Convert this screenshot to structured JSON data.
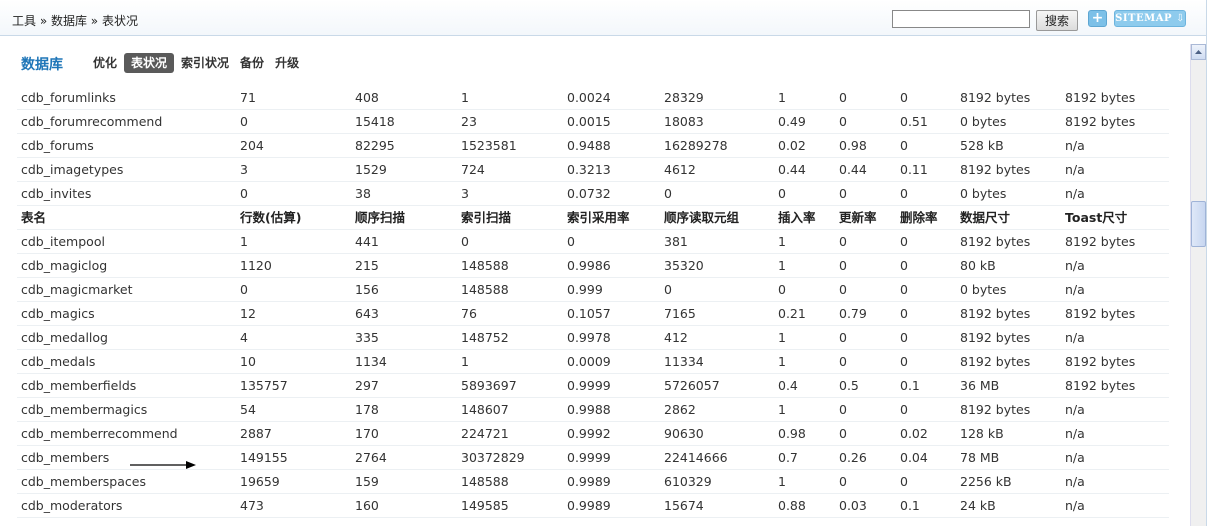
{
  "breadcrumb": "工具 » 数据库 » 表状况",
  "search": {
    "button_label": "搜索",
    "value": ""
  },
  "header_buttons": {
    "plus_label": "+",
    "sitemap_label": "SITEMAP ⇩"
  },
  "page": {
    "title": "数据库",
    "tabs": [
      {
        "label": "优化",
        "active": false
      },
      {
        "label": "表状况",
        "active": true
      },
      {
        "label": "索引状况",
        "active": false
      },
      {
        "label": "备份",
        "active": false
      },
      {
        "label": "升级",
        "active": false
      }
    ]
  },
  "table": {
    "rows_before_header": [
      [
        "cdb_forumlinks",
        "71",
        "408",
        "1",
        "0.0024",
        "28329",
        "1",
        "0",
        "0",
        "8192 bytes",
        "8192 bytes"
      ],
      [
        "cdb_forumrecommend",
        "0",
        "15418",
        "23",
        "0.0015",
        "18083",
        "0.49",
        "0",
        "0.51",
        "0 bytes",
        "8192 bytes"
      ],
      [
        "cdb_forums",
        "204",
        "82295",
        "1523581",
        "0.9488",
        "16289278",
        "0.02",
        "0.98",
        "0",
        "528 kB",
        "n/a"
      ],
      [
        "cdb_imagetypes",
        "3",
        "1529",
        "724",
        "0.3213",
        "4612",
        "0.44",
        "0.44",
        "0.11",
        "8192 bytes",
        "n/a"
      ],
      [
        "cdb_invites",
        "0",
        "38",
        "3",
        "0.0732",
        "0",
        "0",
        "0",
        "0",
        "0 bytes",
        "n/a"
      ]
    ],
    "columns": [
      "表名",
      "行数(估算)",
      "顺序扫描",
      "索引扫描",
      "索引采用率",
      "顺序读取元组",
      "插入率",
      "更新率",
      "删除率",
      "数据尺寸",
      "Toast尺寸"
    ],
    "rows_after_header": [
      [
        "cdb_itempool",
        "1",
        "441",
        "0",
        "0",
        "381",
        "1",
        "0",
        "0",
        "8192 bytes",
        "8192 bytes"
      ],
      [
        "cdb_magiclog",
        "1120",
        "215",
        "148588",
        "0.9986",
        "35320",
        "1",
        "0",
        "0",
        "80 kB",
        "n/a"
      ],
      [
        "cdb_magicmarket",
        "0",
        "156",
        "148588",
        "0.999",
        "0",
        "0",
        "0",
        "0",
        "0 bytes",
        "n/a"
      ],
      [
        "cdb_magics",
        "12",
        "643",
        "76",
        "0.1057",
        "7165",
        "0.21",
        "0.79",
        "0",
        "8192 bytes",
        "8192 bytes"
      ],
      [
        "cdb_medallog",
        "4",
        "335",
        "148752",
        "0.9978",
        "412",
        "1",
        "0",
        "0",
        "8192 bytes",
        "n/a"
      ],
      [
        "cdb_medals",
        "10",
        "1134",
        "1",
        "0.0009",
        "11334",
        "1",
        "0",
        "0",
        "8192 bytes",
        "8192 bytes"
      ],
      [
        "cdb_memberfields",
        "135757",
        "297",
        "5893697",
        "0.9999",
        "5726057",
        "0.4",
        "0.5",
        "0.1",
        "36 MB",
        "8192 bytes"
      ],
      [
        "cdb_membermagics",
        "54",
        "178",
        "148607",
        "0.9988",
        "2862",
        "1",
        "0",
        "0",
        "8192 bytes",
        "n/a"
      ],
      [
        "cdb_memberrecommend",
        "2887",
        "170",
        "224721",
        "0.9992",
        "90630",
        "0.98",
        "0",
        "0.02",
        "128 kB",
        "n/a"
      ],
      [
        "cdb_members",
        "149155",
        "2764",
        "30372829",
        "0.9999",
        "22414666",
        "0.7",
        "0.26",
        "0.04",
        "78 MB",
        "n/a"
      ],
      [
        "cdb_memberspaces",
        "19659",
        "159",
        "148588",
        "0.9989",
        "610329",
        "1",
        "0",
        "0",
        "2256 kB",
        "n/a"
      ],
      [
        "cdb_moderators",
        "473",
        "160",
        "149585",
        "0.9989",
        "15674",
        "0.88",
        "0.03",
        "0.1",
        "24 kB",
        "n/a"
      ]
    ]
  }
}
